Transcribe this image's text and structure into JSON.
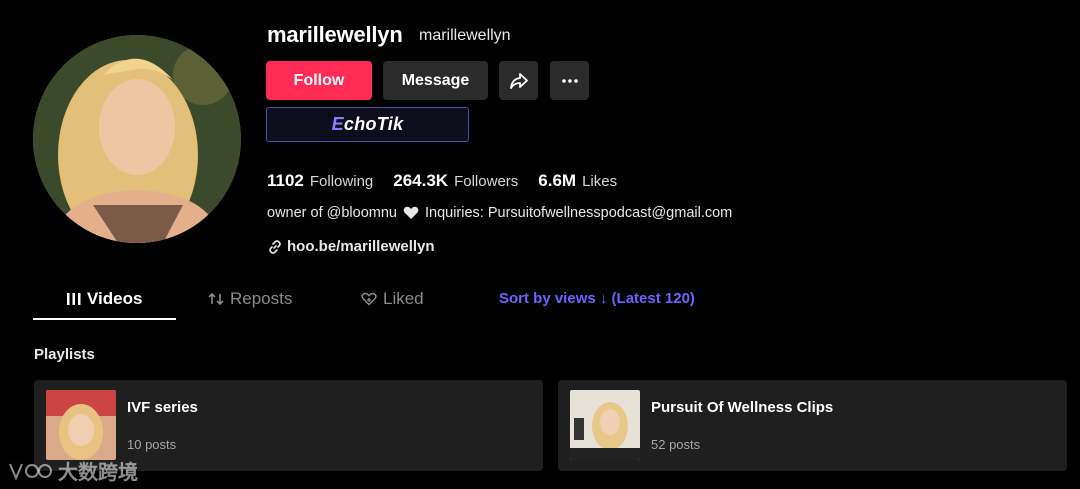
{
  "profile": {
    "username": "marillewellyn",
    "nickname": "marillewellyn"
  },
  "actions": {
    "follow_label": "Follow",
    "message_label": "Message",
    "share_icon": "share-icon",
    "more_icon": "more-icon"
  },
  "badge": {
    "prefix": "E",
    "rest": "choTik"
  },
  "stats": [
    {
      "value": "1102",
      "label": "Following"
    },
    {
      "value": "264.3K",
      "label": "Followers"
    },
    {
      "value": "6.6M",
      "label": "Likes"
    }
  ],
  "bio": {
    "part1": "owner of @bloomnu",
    "heart_icon": "heart-icon",
    "part2": "Inquiries: Pursuitofwellnesspodcast@gmail.com"
  },
  "link": {
    "text": "hoo.be/marillewellyn",
    "icon": "link-icon"
  },
  "tabs": [
    {
      "label": "Videos",
      "icon": "grid-icon",
      "active": true
    },
    {
      "label": "Reposts",
      "icon": "repost-icon",
      "active": false
    },
    {
      "label": "Liked",
      "icon": "liked-icon",
      "active": false
    }
  ],
  "sort_label": "Sort by views ↓ (Latest 120)",
  "playlists": {
    "title": "Playlists",
    "items": [
      {
        "title": "IVF series",
        "count": "10 posts"
      },
      {
        "title": "Pursuit Of Wellness Clips",
        "count": "52 posts"
      }
    ]
  },
  "watermark": "大数跨境",
  "colors": {
    "follow": "#fe2c55",
    "sort_link": "#6e62ff",
    "background": "#000000",
    "card": "#1f1f1f"
  }
}
